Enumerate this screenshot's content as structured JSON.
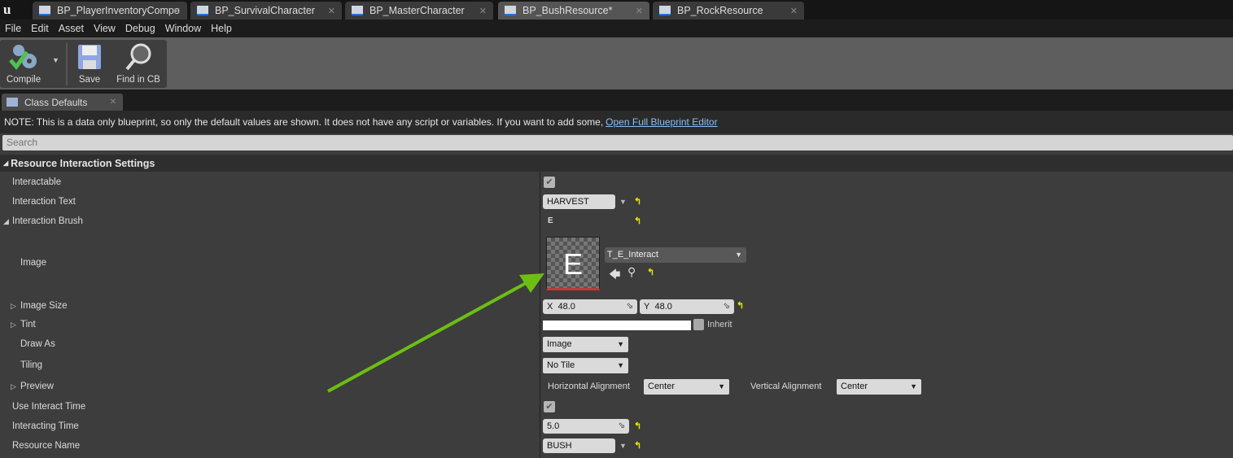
{
  "tabs": [
    "BP_PlayerInventoryCompo",
    "BP_SurvivalCharacter",
    "BP_MasterCharacter",
    "BP_BushResource*",
    "BP_RockResource"
  ],
  "menu": [
    "File",
    "Edit",
    "Asset",
    "View",
    "Debug",
    "Window",
    "Help"
  ],
  "toolbar": {
    "compile": "Compile",
    "save": "Save",
    "find": "Find in CB"
  },
  "details_tab": "Class Defaults",
  "note": {
    "text": "NOTE: This is a data only blueprint, so only the default values are shown.  It does not have any script or variables.  If you want to add some,",
    "link": "Open Full Blueprint Editor"
  },
  "search_placeholder": "Search",
  "category": "Resource Interaction Settings",
  "props": {
    "interactable": {
      "label": "Interactable",
      "checked": true
    },
    "interaction_text": {
      "label": "Interaction Text",
      "value": "HARVEST"
    },
    "interaction_brush": {
      "label": "Interaction Brush",
      "value": "E"
    },
    "image": {
      "label": "Image",
      "asset": "T_E_Interact",
      "thumb_letter": "E"
    },
    "image_size": {
      "label": "Image Size",
      "x_label": "X",
      "x": "48.0",
      "y_label": "Y",
      "y": "48.0"
    },
    "tint": {
      "label": "Tint",
      "inherit": "Inherit"
    },
    "draw_as": {
      "label": "Draw As",
      "value": "Image"
    },
    "tiling": {
      "label": "Tiling",
      "value": "No Tile"
    },
    "preview": {
      "label": "Preview",
      "h_label": "Horizontal Alignment",
      "h": "Center",
      "v_label": "Vertical Alignment",
      "v": "Center"
    },
    "use_interact_time": {
      "label": "Use Interact Time",
      "checked": true
    },
    "interacting_time": {
      "label": "Interacting Time",
      "value": "5.0"
    },
    "resource_name": {
      "label": "Resource Name",
      "value": "BUSH"
    }
  }
}
